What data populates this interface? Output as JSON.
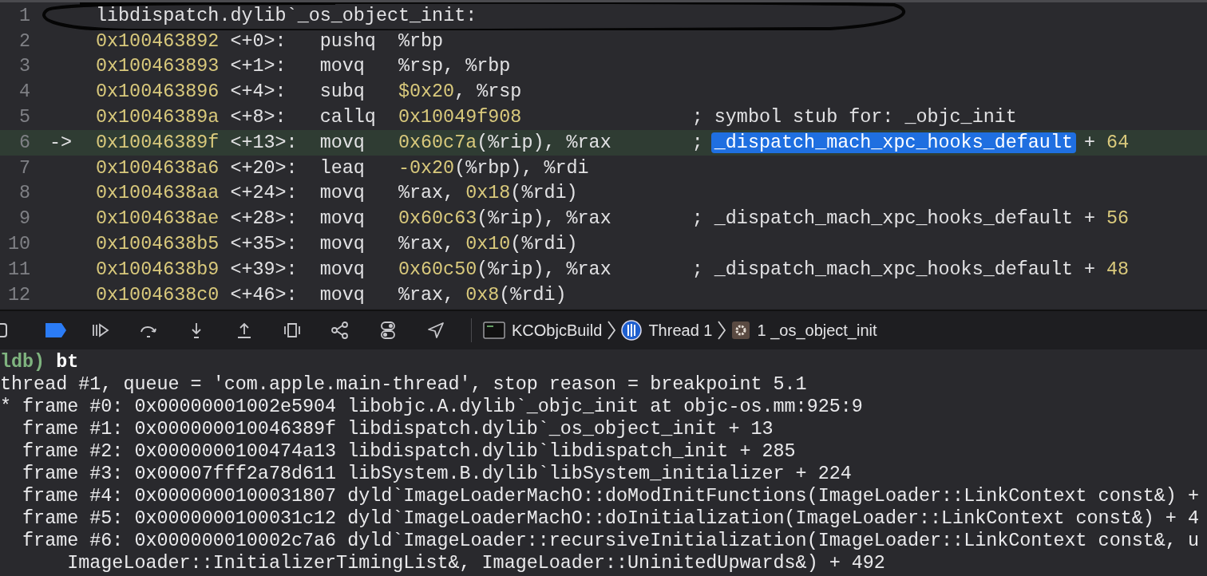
{
  "editor": {
    "rows": [
      {
        "number": "1",
        "current": false,
        "kind": "label",
        "text": "libdispatch.dylib`_os_object_init:"
      },
      {
        "number": "2",
        "current": false,
        "kind": "instruction",
        "address": "0x100463892",
        "offset": "<+0>:",
        "mnemonic": "pushq",
        "operands": [
          {
            "kind": "plain",
            "text": "%rbp"
          }
        ]
      },
      {
        "number": "3",
        "current": false,
        "kind": "instruction",
        "address": "0x100463893",
        "offset": "<+1>:",
        "mnemonic": "movq",
        "operands": [
          {
            "kind": "plain",
            "text": "%rsp, %rbp"
          }
        ]
      },
      {
        "number": "4",
        "current": false,
        "kind": "instruction",
        "address": "0x100463896",
        "offset": "<+4>:",
        "mnemonic": "subq",
        "operands": [
          {
            "kind": "number",
            "text": "$0x20"
          },
          {
            "kind": "plain",
            "text": ", %rsp"
          }
        ]
      },
      {
        "number": "5",
        "current": false,
        "kind": "instruction",
        "address": "0x10046389a",
        "offset": "<+8>:",
        "mnemonic": "callq",
        "operands": [
          {
            "kind": "number",
            "text": "0x10049f908"
          }
        ],
        "comment": [
          {
            "kind": "plain",
            "text": "; symbol stub for: _objc_init"
          }
        ]
      },
      {
        "number": "6",
        "current": true,
        "marker": "->",
        "kind": "instruction",
        "address": "0x10046389f",
        "offset": "<+13>:",
        "mnemonic": "movq",
        "operands": [
          {
            "kind": "number",
            "text": "0x60c7a"
          },
          {
            "kind": "plain",
            "text": "(%rip), %rax"
          }
        ],
        "comment": [
          {
            "kind": "plain",
            "text": "; "
          },
          {
            "kind": "selection",
            "text": "_dispatch_mach_xpc_hooks_default"
          },
          {
            "kind": "plain",
            "text": " + "
          },
          {
            "kind": "number",
            "text": "64"
          }
        ]
      },
      {
        "number": "7",
        "current": false,
        "kind": "instruction",
        "address": "0x1004638a6",
        "offset": "<+20>:",
        "mnemonic": "leaq",
        "operands": [
          {
            "kind": "number",
            "text": "-0x20"
          },
          {
            "kind": "plain",
            "text": "(%rbp), %rdi"
          }
        ]
      },
      {
        "number": "8",
        "current": false,
        "kind": "instruction",
        "address": "0x1004638aa",
        "offset": "<+24>:",
        "mnemonic": "movq",
        "operands": [
          {
            "kind": "plain",
            "text": "%rax, "
          },
          {
            "kind": "number",
            "text": "0x18"
          },
          {
            "kind": "plain",
            "text": "(%rdi)"
          }
        ]
      },
      {
        "number": "9",
        "current": false,
        "kind": "instruction",
        "address": "0x1004638ae",
        "offset": "<+28>:",
        "mnemonic": "movq",
        "operands": [
          {
            "kind": "number",
            "text": "0x60c63"
          },
          {
            "kind": "plain",
            "text": "(%rip), %rax"
          }
        ],
        "comment": [
          {
            "kind": "plain",
            "text": "; _dispatch_mach_xpc_hooks_default + "
          },
          {
            "kind": "number",
            "text": "56"
          }
        ]
      },
      {
        "number": "10",
        "current": false,
        "kind": "instruction",
        "address": "0x1004638b5",
        "offset": "<+35>:",
        "mnemonic": "movq",
        "operands": [
          {
            "kind": "plain",
            "text": "%rax, "
          },
          {
            "kind": "number",
            "text": "0x10"
          },
          {
            "kind": "plain",
            "text": "(%rdi)"
          }
        ]
      },
      {
        "number": "11",
        "current": false,
        "kind": "instruction",
        "address": "0x1004638b9",
        "offset": "<+39>:",
        "mnemonic": "movq",
        "operands": [
          {
            "kind": "number",
            "text": "0x60c50"
          },
          {
            "kind": "plain",
            "text": "(%rip), %rax"
          }
        ],
        "comment": [
          {
            "kind": "plain",
            "text": "; _dispatch_mach_xpc_hooks_default + "
          },
          {
            "kind": "number",
            "text": "48"
          }
        ]
      },
      {
        "number": "12",
        "current": false,
        "kind": "instruction",
        "address": "0x1004638c0",
        "offset": "<+46>:",
        "mnemonic": "movq",
        "operands": [
          {
            "kind": "plain",
            "text": "%rax, "
          },
          {
            "kind": "number",
            "text": "0x8"
          },
          {
            "kind": "plain",
            "text": "(%rdi)"
          }
        ]
      }
    ]
  },
  "debug_bar": {
    "breakpoints_active": true,
    "breadcrumbs": [
      {
        "kind": "target",
        "label": "KCObjcBuild"
      },
      {
        "kind": "thread",
        "label": "Thread 1"
      },
      {
        "kind": "frame",
        "label": "1 _os_object_init"
      }
    ]
  },
  "console": {
    "lines": [
      [
        {
          "kind": "prompt",
          "text": "ldb)"
        },
        {
          "kind": "command",
          "text": " bt"
        }
      ],
      [
        {
          "kind": "plain",
          "text": "thread #1, queue = 'com.apple.main-thread', stop reason = breakpoint 5.1"
        }
      ],
      [
        {
          "kind": "plain",
          "text": "* frame #0: 0x00000001002e5904 libobjc.A.dylib`_objc_init at objc-os.mm:925:9"
        }
      ],
      [
        {
          "kind": "plain",
          "text": "  frame #1: 0x000000010046389f libdispatch.dylib`_os_object_init + 13"
        }
      ],
      [
        {
          "kind": "plain",
          "text": "  frame #2: 0x0000000100474a13 libdispatch.dylib`libdispatch_init + 285"
        }
      ],
      [
        {
          "kind": "plain",
          "text": "  frame #3: 0x00007fff2a78d611 libSystem.B.dylib`libSystem_initializer + 224"
        }
      ],
      [
        {
          "kind": "plain",
          "text": "  frame #4: 0x0000000100031807 dyld`ImageLoaderMachO::doModInitFunctions(ImageLoader::LinkContext const&) +"
        }
      ],
      [
        {
          "kind": "plain",
          "text": "  frame #5: 0x0000000100031c12 dyld`ImageLoaderMachO::doInitialization(ImageLoader::LinkContext const&) + 4"
        }
      ],
      [
        {
          "kind": "plain",
          "text": "  frame #6: 0x000000010002c7a6 dyld`ImageLoader::recursiveInitialization(ImageLoader::LinkContext const&, u"
        }
      ],
      [
        {
          "kind": "plain",
          "text": "      ImageLoader::InitializerTimingList&, ImageLoader::UninitedUpwards&) + 492"
        }
      ]
    ]
  }
}
